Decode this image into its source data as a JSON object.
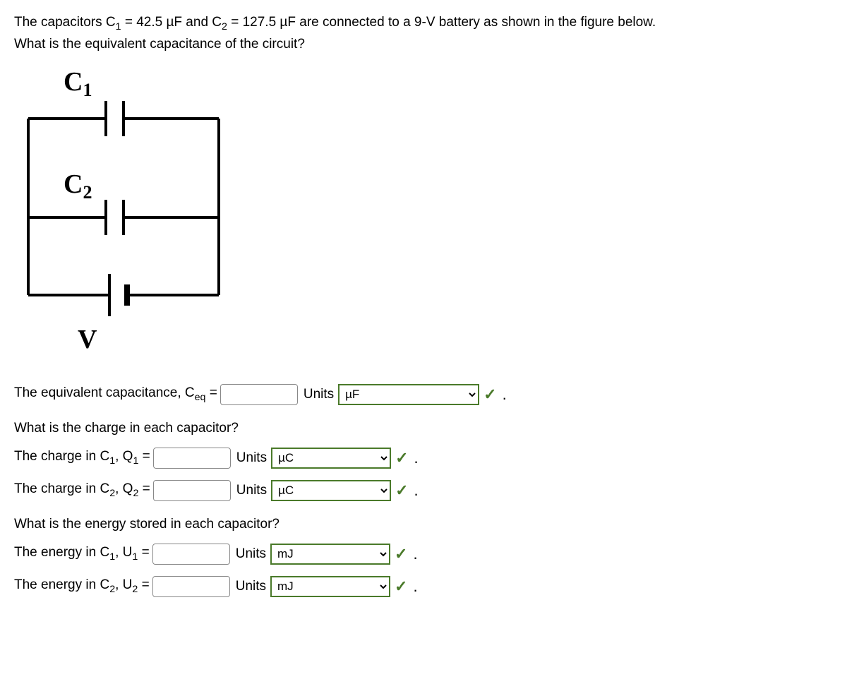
{
  "problem": {
    "line1_a": "The capacitors C",
    "line1_b": " = 42.5 µF and C",
    "line1_c": " = 127.5 µF are connected to a 9-V battery as shown in the figure below.",
    "line2": "What is the equivalent capacitance of the circuit?"
  },
  "diagram": {
    "c1": "C",
    "c1sub": "1",
    "c2": "C",
    "c2sub": "2",
    "v": "V"
  },
  "ceq": {
    "label_a": "The equivalent capacitance, C",
    "label_b": " = ",
    "units_label": "Units",
    "unit_value": "µF"
  },
  "q_charge_header": "What is the charge in each capacitor?",
  "q1": {
    "label_a": "The charge in C",
    "label_b": ", Q",
    "label_c": " = ",
    "units_label": "Units",
    "unit_value": "µC"
  },
  "q2": {
    "label_a": "The charge in C",
    "label_b": ", Q",
    "label_c": " = ",
    "units_label": "Units",
    "unit_value": "µC"
  },
  "q_energy_header": "What is the energy stored in each capacitor?",
  "u1": {
    "label_a": "The energy in C",
    "label_b": ", U",
    "label_c": " = ",
    "units_label": "Units",
    "unit_value": "mJ"
  },
  "u2": {
    "label_a": "The energy in C",
    "label_b": ", U",
    "label_c": " = ",
    "units_label": "Units",
    "unit_value": "mJ"
  },
  "check_mark": "✓",
  "period": "."
}
